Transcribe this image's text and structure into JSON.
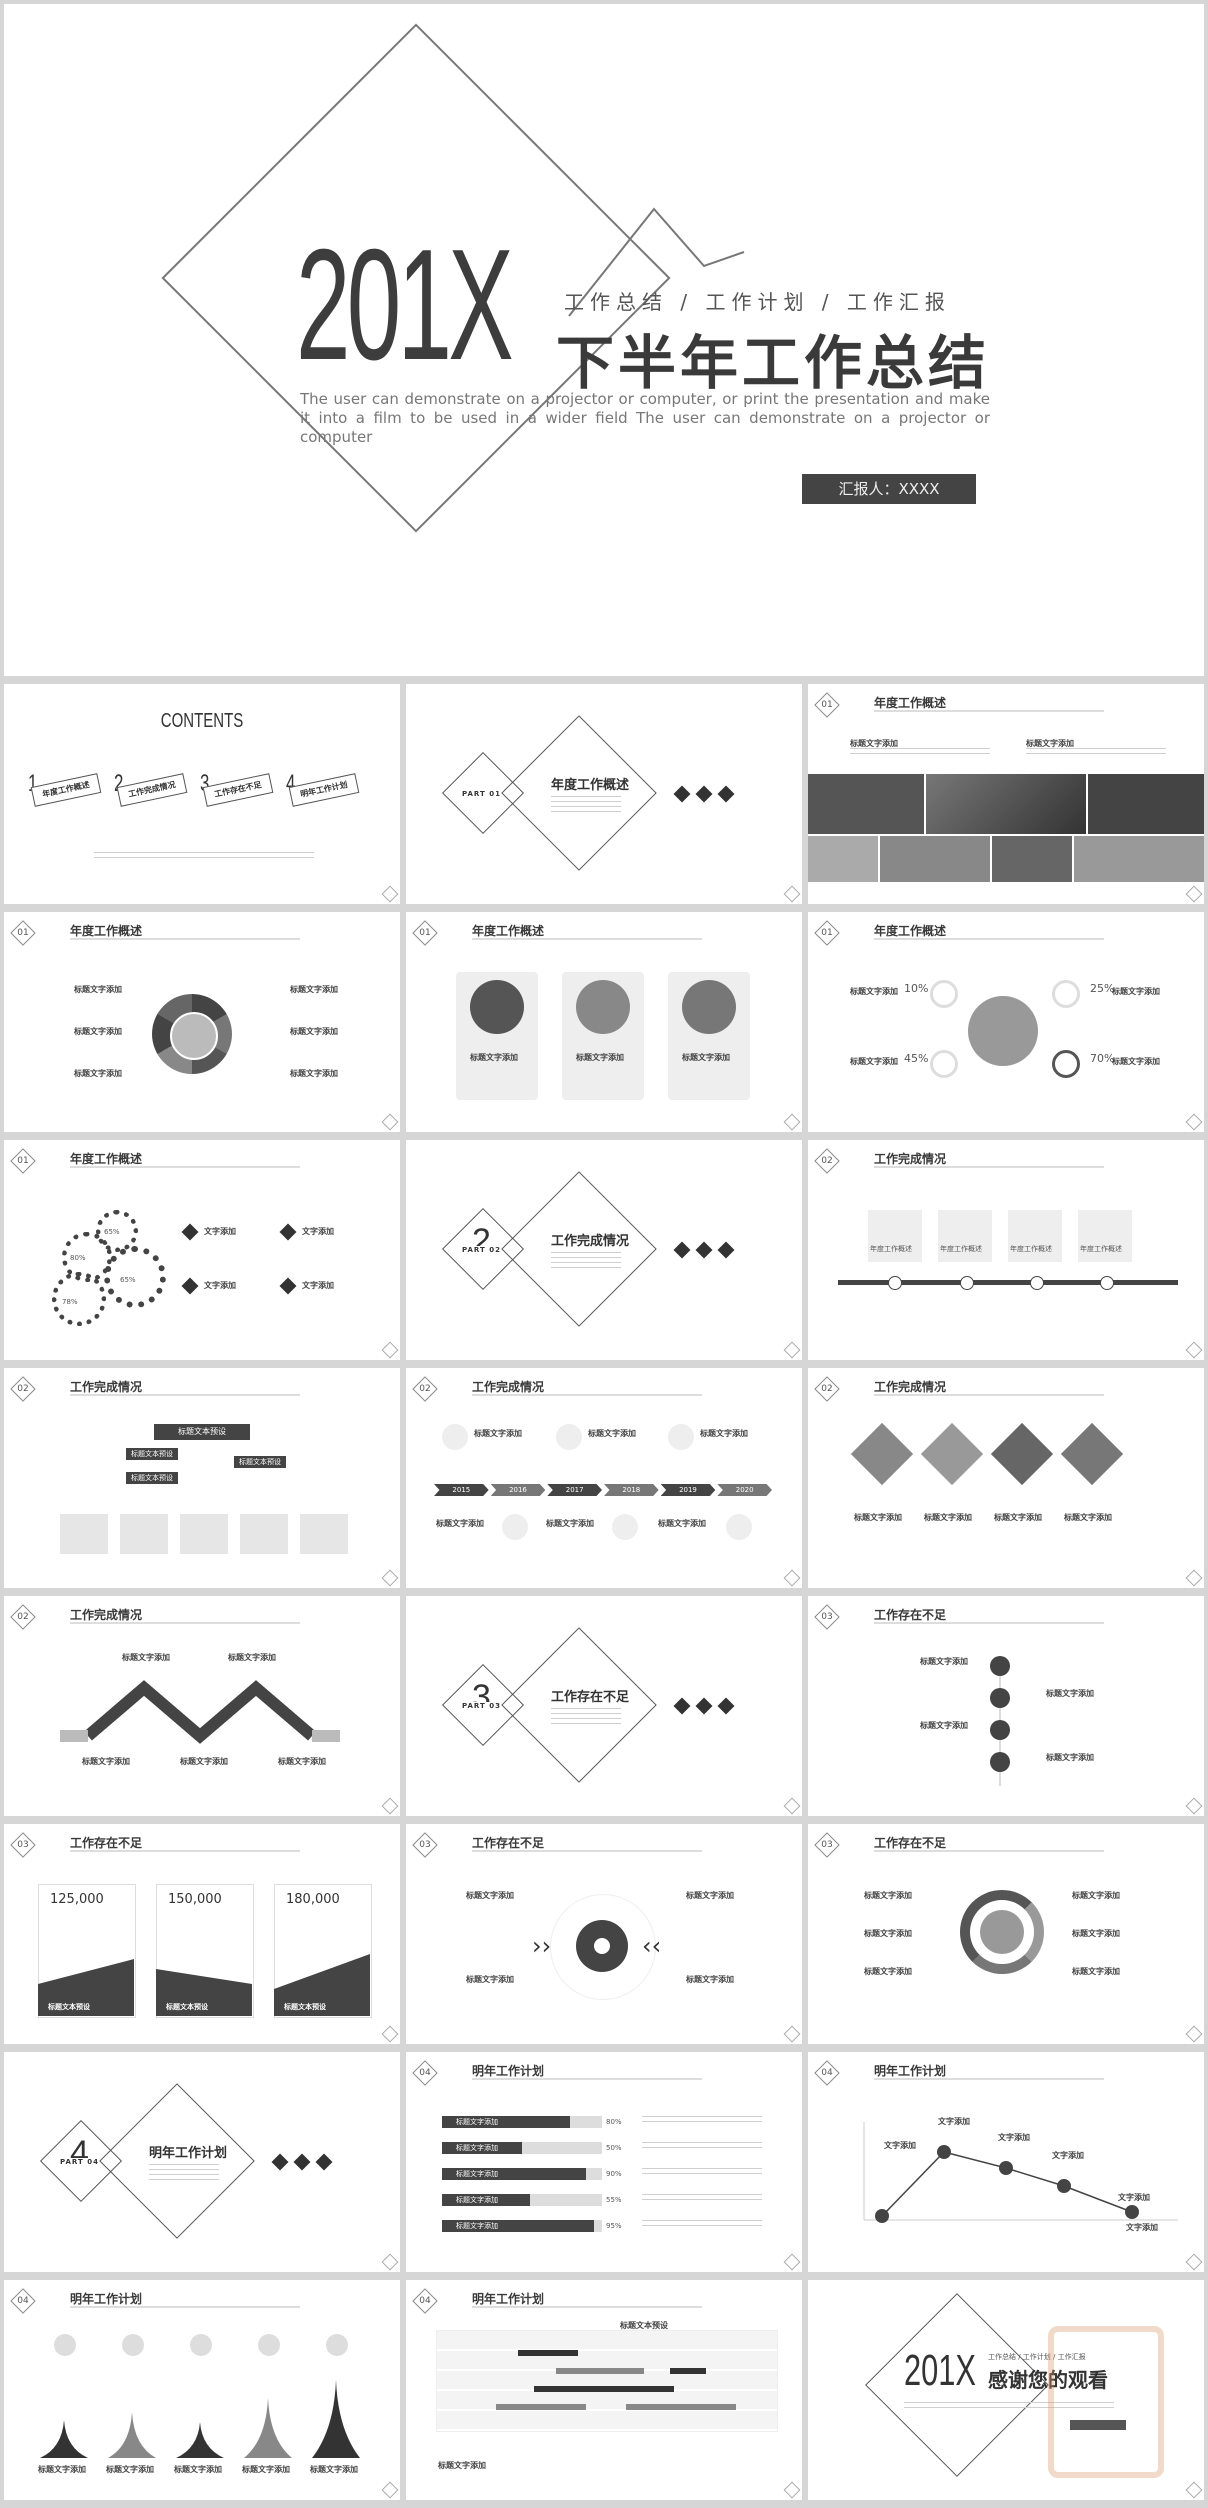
{
  "cover": {
    "year": "201X",
    "tagline": "工作总结 / 工作计划 / 工作汇报",
    "title": "下半年工作总结",
    "description": "The user can demonstrate on a projector or computer, or print the presentation and make it into a film to be used in a wider field The user can demonstrate on a projector or computer",
    "reporter": "汇报人：XXXX"
  },
  "contents": {
    "title": "CONTENTS",
    "items": [
      {
        "num": "1",
        "label": "年度工作概述"
      },
      {
        "num": "2",
        "label": "工作完成情况"
      },
      {
        "num": "3",
        "label": "工作存在不足"
      },
      {
        "num": "4",
        "label": "明年工作计划"
      }
    ]
  },
  "parts": [
    {
      "num": "1",
      "label": "PART 01",
      "title": "年度工作概述"
    },
    {
      "num": "2",
      "label": "PART 02",
      "title": "工作完成情况"
    },
    {
      "num": "3",
      "label": "PART 03",
      "title": "工作存在不足"
    },
    {
      "num": "4",
      "label": "PART 04",
      "title": "明年工作计划"
    }
  ],
  "section_nums": [
    "01",
    "02",
    "03",
    "04"
  ],
  "sections": {
    "s1": "年度工作概述",
    "s2": "工作完成情况",
    "s3": "工作存在不足",
    "s4": "明年工作计划"
  },
  "labels": {
    "text_add": "标题文字添加",
    "text_short": "文字添加",
    "text_box": "标题文本预设",
    "desc_short": "年度工作概述"
  },
  "percent_stats": [
    "10%",
    "25%",
    "45%",
    "70%"
  ],
  "gear_stats": [
    "65%",
    "80%",
    "65%",
    "78%"
  ],
  "timeline_years": [
    "2015",
    "2016",
    "2017",
    "2018",
    "2019",
    "2020"
  ],
  "numbers": [
    "125,000",
    "150,000",
    "180,000"
  ],
  "bar_stats": [
    "80%",
    "50%",
    "90%",
    "55%",
    "95%"
  ],
  "ending": {
    "year": "201X",
    "tagline": "工作总结 / 工作计划 / 工作汇报",
    "title": "感谢您的观看"
  },
  "colors": {
    "dark": "#3a3a3a",
    "mid": "#777777",
    "light": "#dcdcdc"
  }
}
